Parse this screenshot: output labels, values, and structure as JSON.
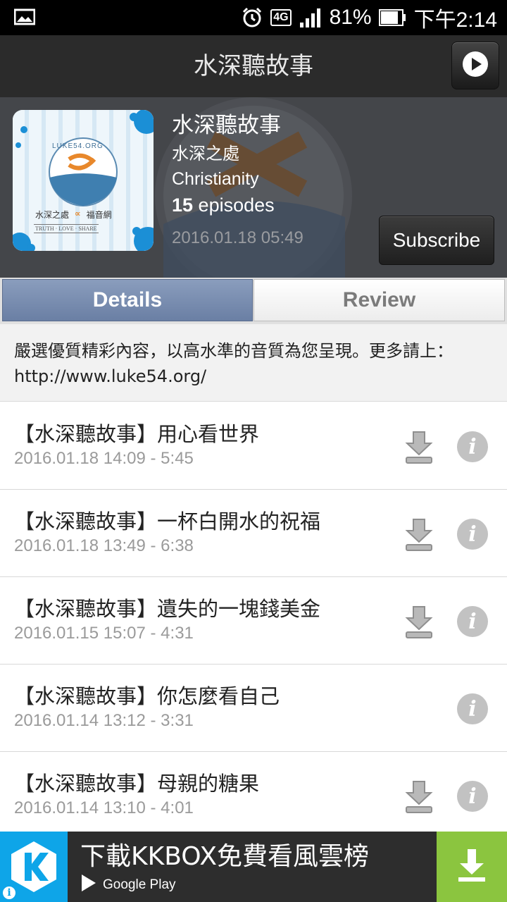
{
  "status_bar": {
    "battery": "81%",
    "time": "下午2:14",
    "network": "4G",
    "icons": [
      "gallery-icon",
      "alarm-icon",
      "signal-icon",
      "battery-icon"
    ]
  },
  "app_bar": {
    "title": "水深聽故事",
    "play_icon": "play-icon"
  },
  "podcast": {
    "title": "水深聽故事",
    "author": "水深之處",
    "category": "Christianity",
    "episode_count": "15",
    "episode_word": " episodes",
    "updated": "2016.01.18 05:49",
    "subscribe_label": "Subscribe",
    "cover": {
      "logo_text": "LUKE54.ORG",
      "brand_left": "水深之處",
      "brand_right": "福音網",
      "motto": "TRUTH · LOVE · SHARE"
    }
  },
  "tabs": {
    "details": "Details",
    "review": "Review",
    "selected": "details"
  },
  "description": "嚴選優質精彩內容，以高水準的音質為您呈現。更多請上：http://www.luke54.org/",
  "episodes": [
    {
      "title": "【水深聽故事】用心看世界",
      "meta": "2016.01.18 14:09 - 5:45",
      "downloadable": true
    },
    {
      "title": "【水深聽故事】一杯白開水的祝福",
      "meta": "2016.01.18 13:49 - 6:38",
      "downloadable": true
    },
    {
      "title": "【水深聽故事】遺失的一塊錢美金",
      "meta": "2016.01.15 15:07 - 4:31",
      "downloadable": true
    },
    {
      "title": "【水深聽故事】你怎麼看自己",
      "meta": "2016.01.14 13:12 - 3:31",
      "downloadable": false
    },
    {
      "title": "【水深聽故事】母親的糖果",
      "meta": "2016.01.14 13:10 - 4:01",
      "downloadable": true
    }
  ],
  "ad": {
    "title": "下載KKBOX免費看風雲榜",
    "store": "Google Play",
    "colors": {
      "logo_bg": "#0ea5e8",
      "download_bg": "#8bc53f",
      "banner_bg": "#2d2d2d"
    }
  },
  "colors": {
    "app_bar": "#2b2b2b",
    "tab_selected": "#7589ad",
    "meta_text": "#9a9a9a"
  }
}
